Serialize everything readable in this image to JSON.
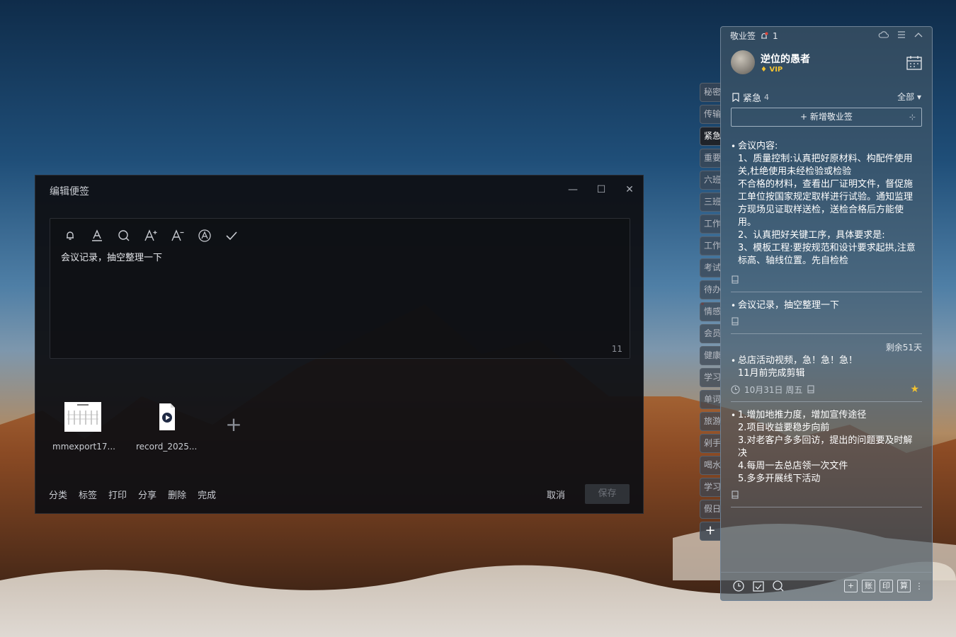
{
  "editor": {
    "title": "编辑便签",
    "content": "会议记录，抽空整理一下",
    "char_count": "11",
    "attachments": [
      {
        "name": "mmexport17...",
        "kind": "image"
      },
      {
        "name": "record_2025...",
        "kind": "video"
      }
    ],
    "actions": [
      "分类",
      "标签",
      "打印",
      "分享",
      "删除",
      "完成"
    ],
    "cancel_label": "取消",
    "save_label": "保存",
    "window_controls": [
      "minimize-icon",
      "maximize-icon",
      "close-icon"
    ],
    "toolbar_icons": [
      "bell-icon",
      "text-color-icon",
      "search-icon",
      "font-increase-icon",
      "font-decrease-icon",
      "style-icon",
      "check-icon"
    ]
  },
  "side_tabs": [
    "秘密",
    "传输",
    "紧急",
    "重要",
    "六班",
    "三班",
    "工作",
    "工作",
    "考试",
    "待办",
    "情感",
    "会员",
    "健康",
    "学习",
    "单词",
    "旅游",
    "剁手",
    "喝水",
    "学习",
    "假日"
  ],
  "side_tabs_active_index": 2,
  "panel": {
    "app_name": "敬业签",
    "notification_count": "1",
    "username": "逆位的愚者",
    "vip_label": "VIP",
    "category": "紧急",
    "category_count": "4",
    "filter_label": "全部",
    "add_note_label": "新增敬业签",
    "notes": [
      {
        "lines": [
          "会议内容:",
          "1、质量控制:认真把好原材料、构配件使用",
          "关,杜绝使用未经检验或检验",
          "不合格的材料，查看出厂证明文件，督促施",
          "工单位按国家规定取样进行试验。通知监理",
          "方现场见证取样送检，送检合格后方能使",
          "用。",
          "2、认真把好关键工序，具体要求是:",
          "3、模板工程:要按规范和设计要求起拱,注意",
          "标高、轴线位置。先自检检"
        ]
      },
      {
        "lines": [
          "会议记录，抽空整理一下"
        ]
      },
      {
        "remaining": "剩余51天",
        "lines": [
          "总店活动视频，急！急！急！",
          "11月前完成剪辑"
        ],
        "date": "10月31日 周五",
        "starred": true
      },
      {
        "lines": [
          "1.增加地推力度，增加宣传途径",
          "2.项目收益要稳步向前",
          "3.对老客户多多回访，提出的问题要及时解",
          "决",
          "4.每周一去总店领一次文件",
          "5.多多开展线下活动"
        ]
      }
    ],
    "footer_right": [
      "+",
      "账",
      "印",
      "算"
    ],
    "colors": {
      "vip": "#f2c230",
      "star": "#f2c230"
    }
  }
}
